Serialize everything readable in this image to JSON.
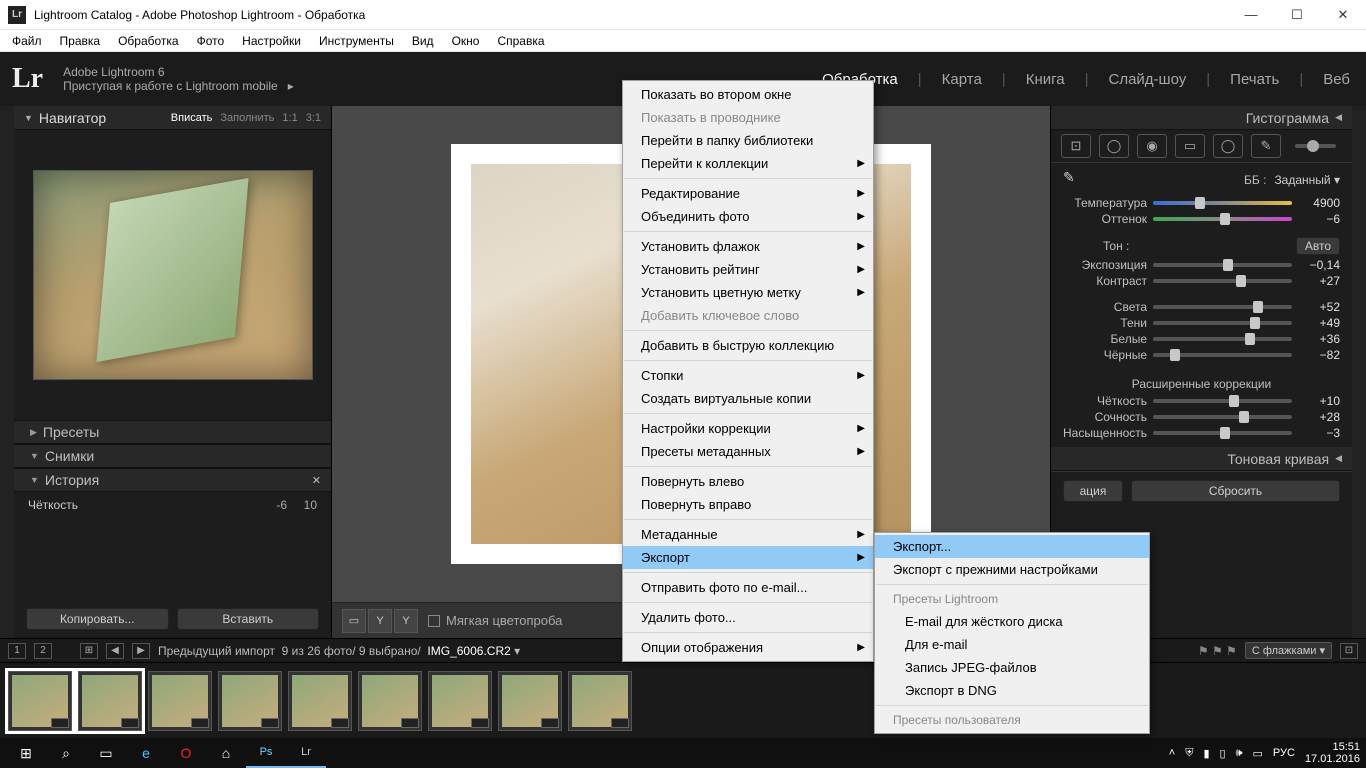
{
  "window": {
    "title": "Lightroom Catalog - Adobe Photoshop Lightroom - Обработка"
  },
  "menubar": [
    "Файл",
    "Правка",
    "Обработка",
    "Фото",
    "Настройки",
    "Инструменты",
    "Вид",
    "Окно",
    "Справка"
  ],
  "brand": {
    "logo": "Lr",
    "line1": "Adobe Lightroom 6",
    "line2": "Приступая к работе с Lightroom mobile",
    "arrow": "▸"
  },
  "modules": [
    {
      "label": "Обработка",
      "active": true
    },
    {
      "label": "Карта",
      "active": false
    },
    {
      "label": "Книга",
      "active": false
    },
    {
      "label": "Слайд-шоу",
      "active": false
    },
    {
      "label": "Печать",
      "active": false
    },
    {
      "label": "Веб",
      "active": false
    }
  ],
  "left": {
    "navigator": {
      "title": "Навигатор",
      "opts": [
        "Вписать",
        "Заполнить",
        "1:1",
        "3:1"
      ],
      "active": 0
    },
    "presets": "Пресеты",
    "snapshots": "Снимки",
    "history": {
      "title": "История",
      "rows": [
        {
          "label": "Чёткость",
          "v1": "-6",
          "v2": "10"
        }
      ]
    },
    "copy_btn": "Копировать...",
    "paste_btn": "Вставить"
  },
  "center": {
    "softproof": "Мягкая цветопроба"
  },
  "right": {
    "histogram": "Гистограмма",
    "wb": {
      "label": "ББ :",
      "value": "Заданный",
      "arrow": "▾"
    },
    "sliders": {
      "temperature": {
        "label": "Температура",
        "value": "4900",
        "pos": 30
      },
      "tint": {
        "label": "Оттенок",
        "value": "−6",
        "pos": 48
      },
      "tone_label": "Тон :",
      "auto": "Авто",
      "exposure": {
        "label": "Экспозиция",
        "value": "−0,14",
        "pos": 50
      },
      "contrast": {
        "label": "Контраст",
        "value": "+27",
        "pos": 60
      },
      "highlights": {
        "label": "Света",
        "value": "+52",
        "pos": 72
      },
      "shadows": {
        "label": "Тени",
        "value": "+49",
        "pos": 70
      },
      "whites": {
        "label": "Белые",
        "value": "+36",
        "pos": 66
      },
      "blacks": {
        "label": "Чёрные",
        "value": "−82",
        "pos": 12
      },
      "adv_label": "Расширенные коррекции",
      "clarity": {
        "label": "Чёткость",
        "value": "+10",
        "pos": 55
      },
      "vibrance": {
        "label": "Сочность",
        "value": "+28",
        "pos": 62
      },
      "saturation": {
        "label": "Насыщенность",
        "value": "−3",
        "pos": 48
      }
    },
    "tonecurve": "Тоновая кривая",
    "reset_btn": "Сбросить",
    "sync_btn": "ация"
  },
  "filmstrip": {
    "prev_import": "Предыдущий импорт",
    "counts": "9 из 26 фото/ 9 выбрано/",
    "filename": "IMG_6006.CR2",
    "arrow": "▾",
    "flag_filter": "С флажками"
  },
  "context_main": {
    "items": [
      {
        "t": "Показать во втором окне"
      },
      {
        "t": "Показать в проводнике",
        "dis": true
      },
      {
        "t": "Перейти в папку библиотеки"
      },
      {
        "t": "Перейти к коллекции",
        "sub": true
      },
      {
        "sep": true
      },
      {
        "t": "Редактирование",
        "sub": true
      },
      {
        "t": "Объединить фото",
        "sub": true
      },
      {
        "sep": true
      },
      {
        "t": "Установить флажок",
        "sub": true
      },
      {
        "t": "Установить рейтинг",
        "sub": true
      },
      {
        "t": "Установить цветную метку",
        "sub": true
      },
      {
        "t": "Добавить ключевое слово",
        "dis": true
      },
      {
        "sep": true
      },
      {
        "t": "Добавить в быструю коллекцию"
      },
      {
        "sep": true
      },
      {
        "t": "Стопки",
        "sub": true
      },
      {
        "t": "Создать виртуальные копии"
      },
      {
        "sep": true
      },
      {
        "t": "Настройки коррекции",
        "sub": true
      },
      {
        "t": "Пресеты метаданных",
        "sub": true
      },
      {
        "sep": true
      },
      {
        "t": "Повернуть влево"
      },
      {
        "t": "Повернуть вправо"
      },
      {
        "sep": true
      },
      {
        "t": "Метаданные",
        "sub": true
      },
      {
        "t": "Экспорт",
        "sub": true,
        "sel": true
      },
      {
        "sep": true
      },
      {
        "t": "Отправить фото по e-mail..."
      },
      {
        "sep": true
      },
      {
        "t": "Удалить фото..."
      },
      {
        "sep": true
      },
      {
        "t": "Опции отображения",
        "sub": true
      }
    ]
  },
  "context_sub": {
    "items": [
      {
        "t": "Экспорт...",
        "sel": true
      },
      {
        "t": "Экспорт с прежними настройками"
      },
      {
        "sep": true
      },
      {
        "h": "Пресеты Lightroom"
      },
      {
        "t": "E-mail для жёсткого диска",
        "indent": true
      },
      {
        "t": "Для e-mail",
        "indent": true
      },
      {
        "t": "Запись JPEG-файлов",
        "indent": true
      },
      {
        "t": "Экспорт в DNG",
        "indent": true
      },
      {
        "sep": true
      },
      {
        "h": "Пресеты пользователя"
      }
    ]
  },
  "taskbar": {
    "lang": "РУС",
    "time": "15:51",
    "date": "17.01.2016"
  }
}
